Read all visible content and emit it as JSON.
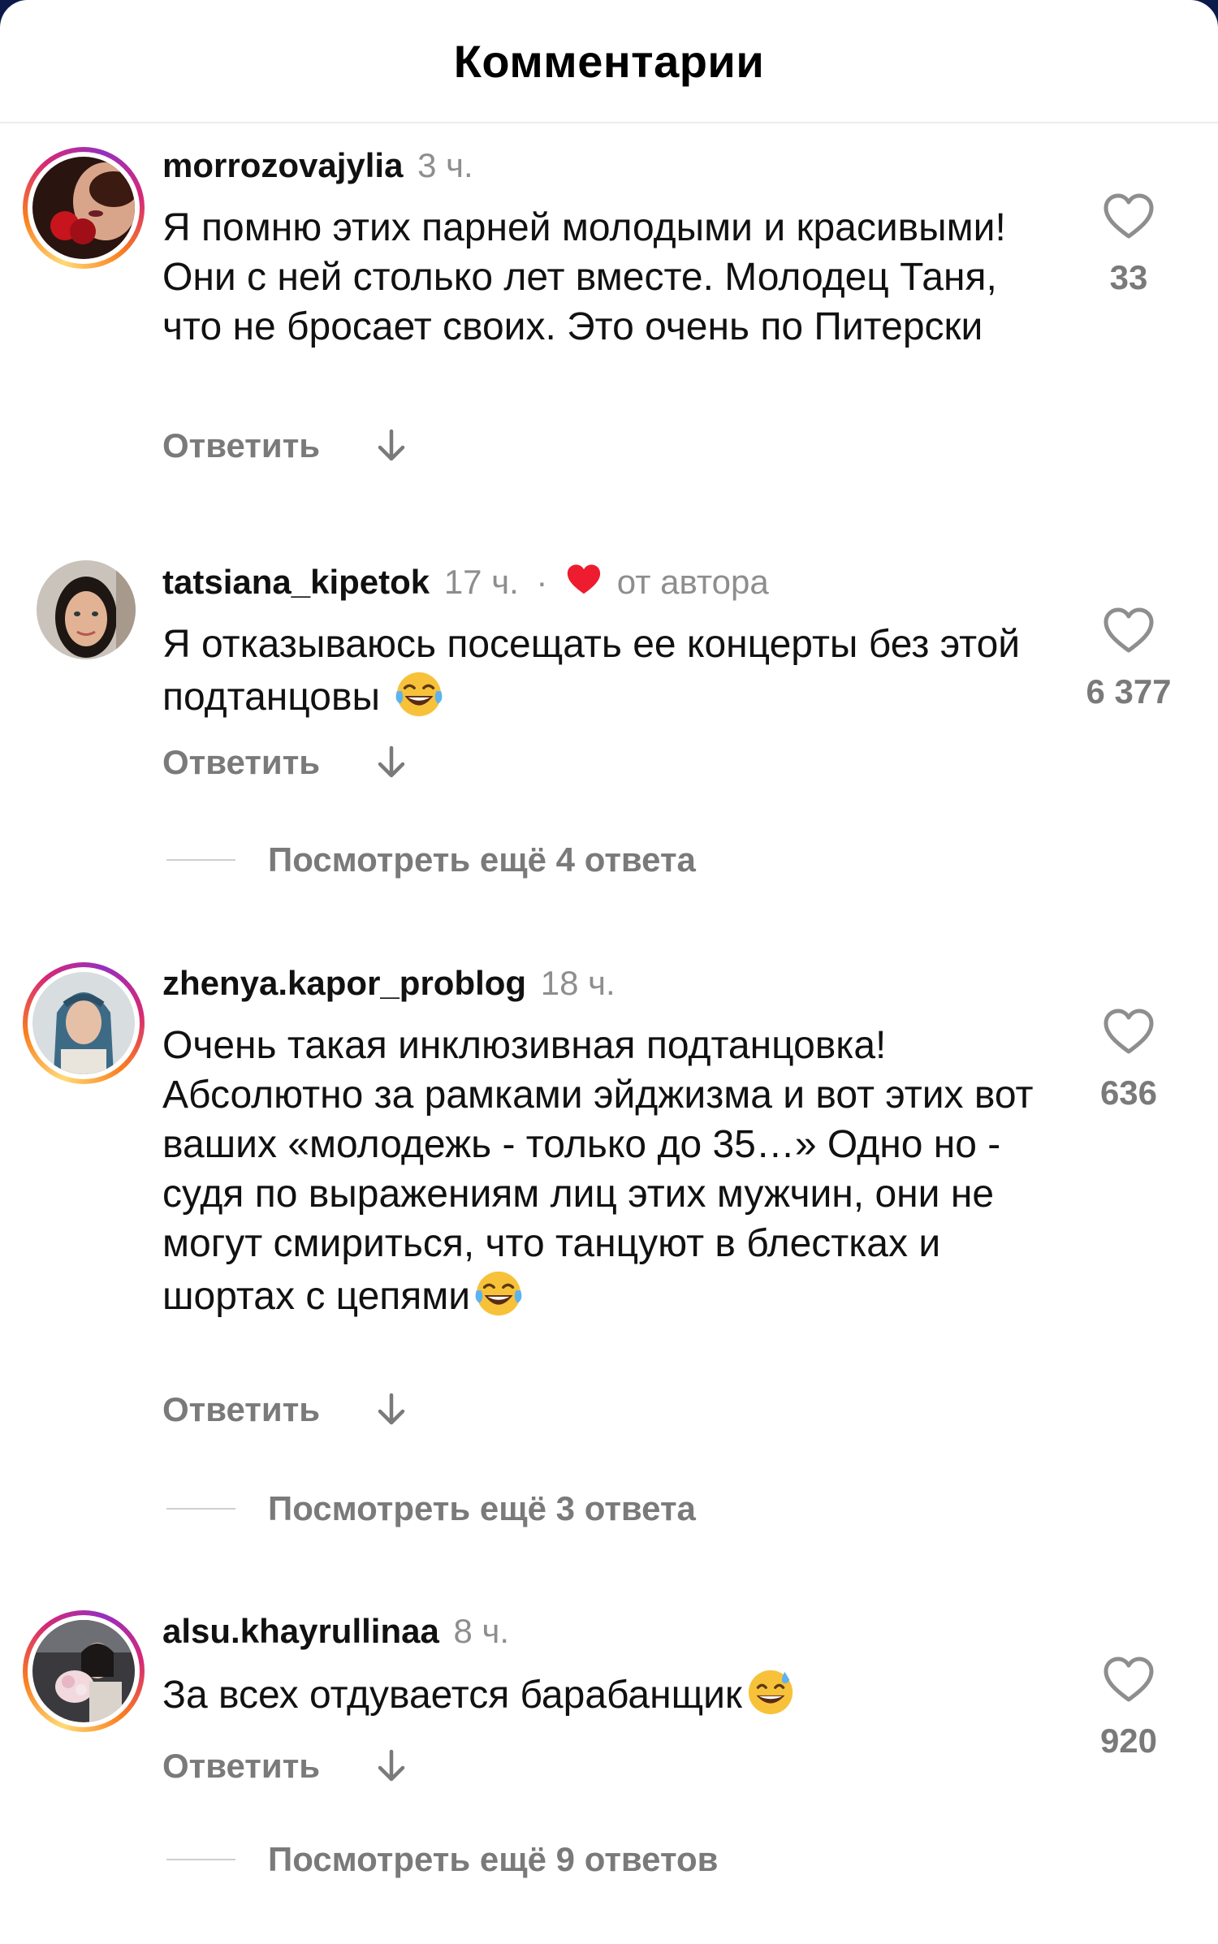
{
  "header": {
    "title": "Комментарии"
  },
  "comments": [
    {
      "username": "morrozovajylia",
      "time": "3 ч.",
      "text": "Я помню этих парней молодыми и красивыми! Они с ней столько лет вместе. Молодец Таня, что не бросает своих. Это очень по Питерски",
      "reply_label": "Ответить",
      "likes": "33",
      "has_story_ring": true
    },
    {
      "username": "tatsiana_kipetok",
      "time": "17 ч.",
      "separator": "·",
      "author_label": "от автора",
      "text": "Я отказываюсь посещать ее концерты без этой подтанцовы",
      "emoji": "tears-of-joy",
      "reply_label": "Ответить",
      "likes": "6 377",
      "more_replies": "Посмотреть ещё 4 ответа",
      "has_story_ring": false
    },
    {
      "username": "zhenya.kapor_problog",
      "time": "18 ч.",
      "text": "Очень такая инклюзивная подтанцовка! Абсолютно за рамками эйджизма и вот этих вот ваших «молодежь - только до 35…» Одно но - судя по выражениям лиц этих мужчин, они не могут смириться, что танцуют в блестках и шортах с цепями",
      "emoji": "tears-of-joy",
      "reply_label": "Ответить",
      "likes": "636",
      "more_replies": "Посмотреть ещё 3 ответа",
      "has_story_ring": true
    },
    {
      "username": "alsu.khayrullinaa",
      "time": "8 ч.",
      "text": "За всех отдувается барабанщик",
      "emoji": "grinning-sweat",
      "reply_label": "Ответить",
      "likes": "920",
      "more_replies": "Посмотреть ещё 9 ответов",
      "has_story_ring": true
    }
  ],
  "colors": {
    "text": "#111111",
    "secondary": "#8e8e8e",
    "author_heart": "#ed1c2e",
    "backdrop": "#0b1a4a"
  },
  "icons": [
    "heart-outline-icon",
    "translate-arrow-icon",
    "author-like-heart-icon",
    "avatar-photo"
  ]
}
